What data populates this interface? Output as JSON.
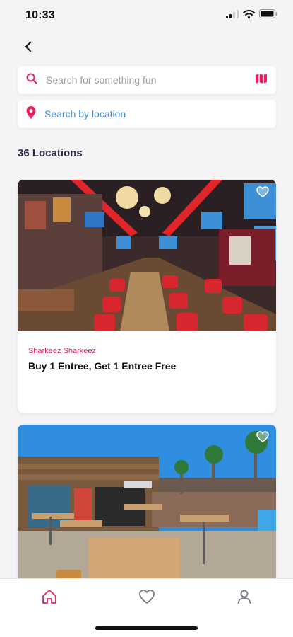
{
  "status_bar": {
    "time": "10:33"
  },
  "search": {
    "placeholder": "Search for something fun"
  },
  "location_search": {
    "label": "Search by location"
  },
  "results": {
    "count_label": "36 Locations"
  },
  "cards": [
    {
      "venue": "Sharkeez Sharkeez",
      "offer": "Buy 1 Entree, Get 1 Entree Free"
    },
    {
      "venue": "",
      "offer": ""
    }
  ],
  "icons": {
    "back": "chevron-left-icon",
    "search": "search-icon",
    "map": "map-icon",
    "location": "location-pin-icon",
    "favorite": "heart-icon",
    "home": "home-icon",
    "profile": "user-icon"
  },
  "colors": {
    "accent": "#e8215b",
    "location_text": "#3b8fd9",
    "background": "#f4f4f6"
  },
  "tabs": [
    {
      "name": "home",
      "active": true
    },
    {
      "name": "favorites",
      "active": false
    },
    {
      "name": "profile",
      "active": false
    }
  ]
}
